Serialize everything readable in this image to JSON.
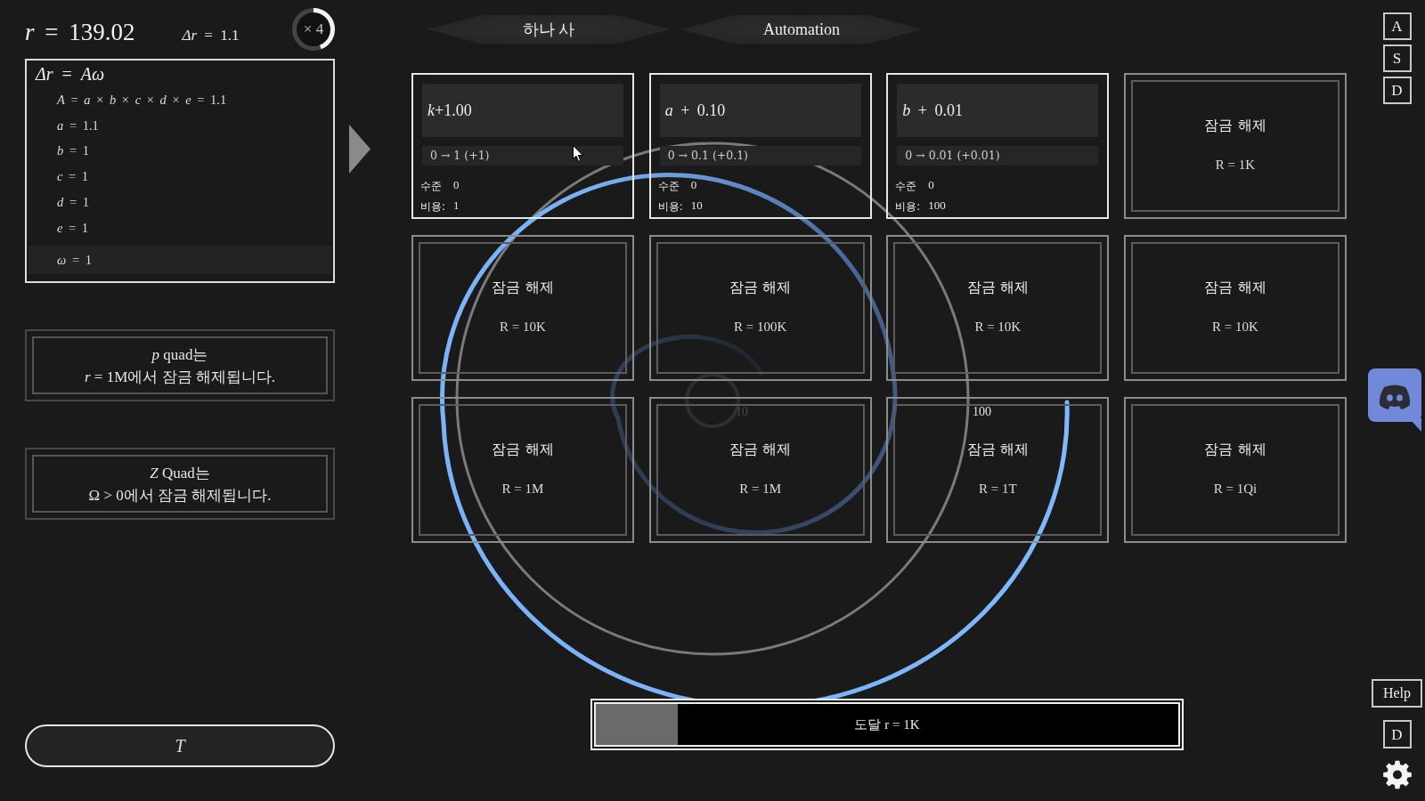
{
  "header": {
    "r_value": "*r* = 139.02",
    "delta_r": "*Δr* = 1.1",
    "multiplier": {
      "text": "× 4",
      "level": 0.44
    }
  },
  "formula_panel": {
    "title": "*Δr* = *Aω*",
    "lines": [
      {
        "text": "*A* = *a* × *b* × *c* × *d* × *e* = 1.1",
        "highlighted": false
      },
      {
        "text": "*a* = 1.1",
        "highlighted": false
      },
      {
        "text": "*b* = 1",
        "highlighted": false
      },
      {
        "text": "*c* = 1",
        "highlighted": false
      },
      {
        "text": "*d* = 1",
        "highlighted": false
      },
      {
        "text": "*e* = 1",
        "highlighted": false
      },
      {
        "text": "*ω* = 1",
        "highlighted": true
      }
    ]
  },
  "locked_quads": [
    {
      "lines": [
        "*p* quad는",
        "*r* = 1M에서 잠금 해제됩니다."
      ]
    },
    {
      "lines": [
        "*Z* Quad는",
        "Ω > 0에서 잠금 해제됩니다."
      ]
    }
  ],
  "t_button": {
    "label": "T"
  },
  "tabs": [
    {
      "label": "하나 사"
    },
    {
      "label": "Automation"
    }
  ],
  "cards": [
    {
      "kind": "upgrade",
      "title": "*k*+1.00",
      "change": "0 → 1 (+1)",
      "tier_label": "수준",
      "tier_value": "0",
      "cost_label": "비용:",
      "cost_value": "1"
    },
    {
      "kind": "upgrade",
      "title": "*a* + 0.10",
      "change": "0 → 0.1 (+0.1)",
      "tier_label": "수준",
      "tier_value": "0",
      "cost_label": "비용:",
      "cost_value": "10"
    },
    {
      "kind": "upgrade",
      "title": "*b* + 0.01",
      "change": "0 → 0.01 (+0.01)",
      "tier_label": "수준",
      "tier_value": "0",
      "cost_label": "비용:",
      "cost_value": "100"
    },
    {
      "kind": "locked",
      "label": "잠금 해제",
      "requirement": "R = 1K"
    },
    {
      "kind": "locked",
      "label": "잠금 해제",
      "requirement": "R = 10K"
    },
    {
      "kind": "locked",
      "label": "잠금 해제",
      "requirement": "R = 100K"
    },
    {
      "kind": "locked",
      "label": "잠금 해제",
      "requirement": "R = 10K"
    },
    {
      "kind": "locked",
      "label": "잠금 해제",
      "requirement": "R = 10K"
    },
    {
      "kind": "locked",
      "label": "잠금 해제",
      "requirement": "R = 1M"
    },
    {
      "kind": "locked",
      "label": "잠금 해제",
      "requirement": "R = 1M"
    },
    {
      "kind": "locked",
      "label": "잠금 해제",
      "requirement": "R = 1T"
    },
    {
      "kind": "locked",
      "label": "잠금 해제",
      "requirement": "R = 1Qi"
    }
  ],
  "spiral": {
    "labels": [
      {
        "text": "10",
        "faded": true
      },
      {
        "text": "100",
        "faded": false
      }
    ]
  },
  "progress": {
    "text": "도달 r = 1K",
    "level": 0.14
  },
  "hotkeys": [
    {
      "label": "A"
    },
    {
      "label": "S"
    },
    {
      "label": "D"
    }
  ],
  "help_button": {
    "label": "Help"
  },
  "bottom_key": {
    "label": "D"
  }
}
